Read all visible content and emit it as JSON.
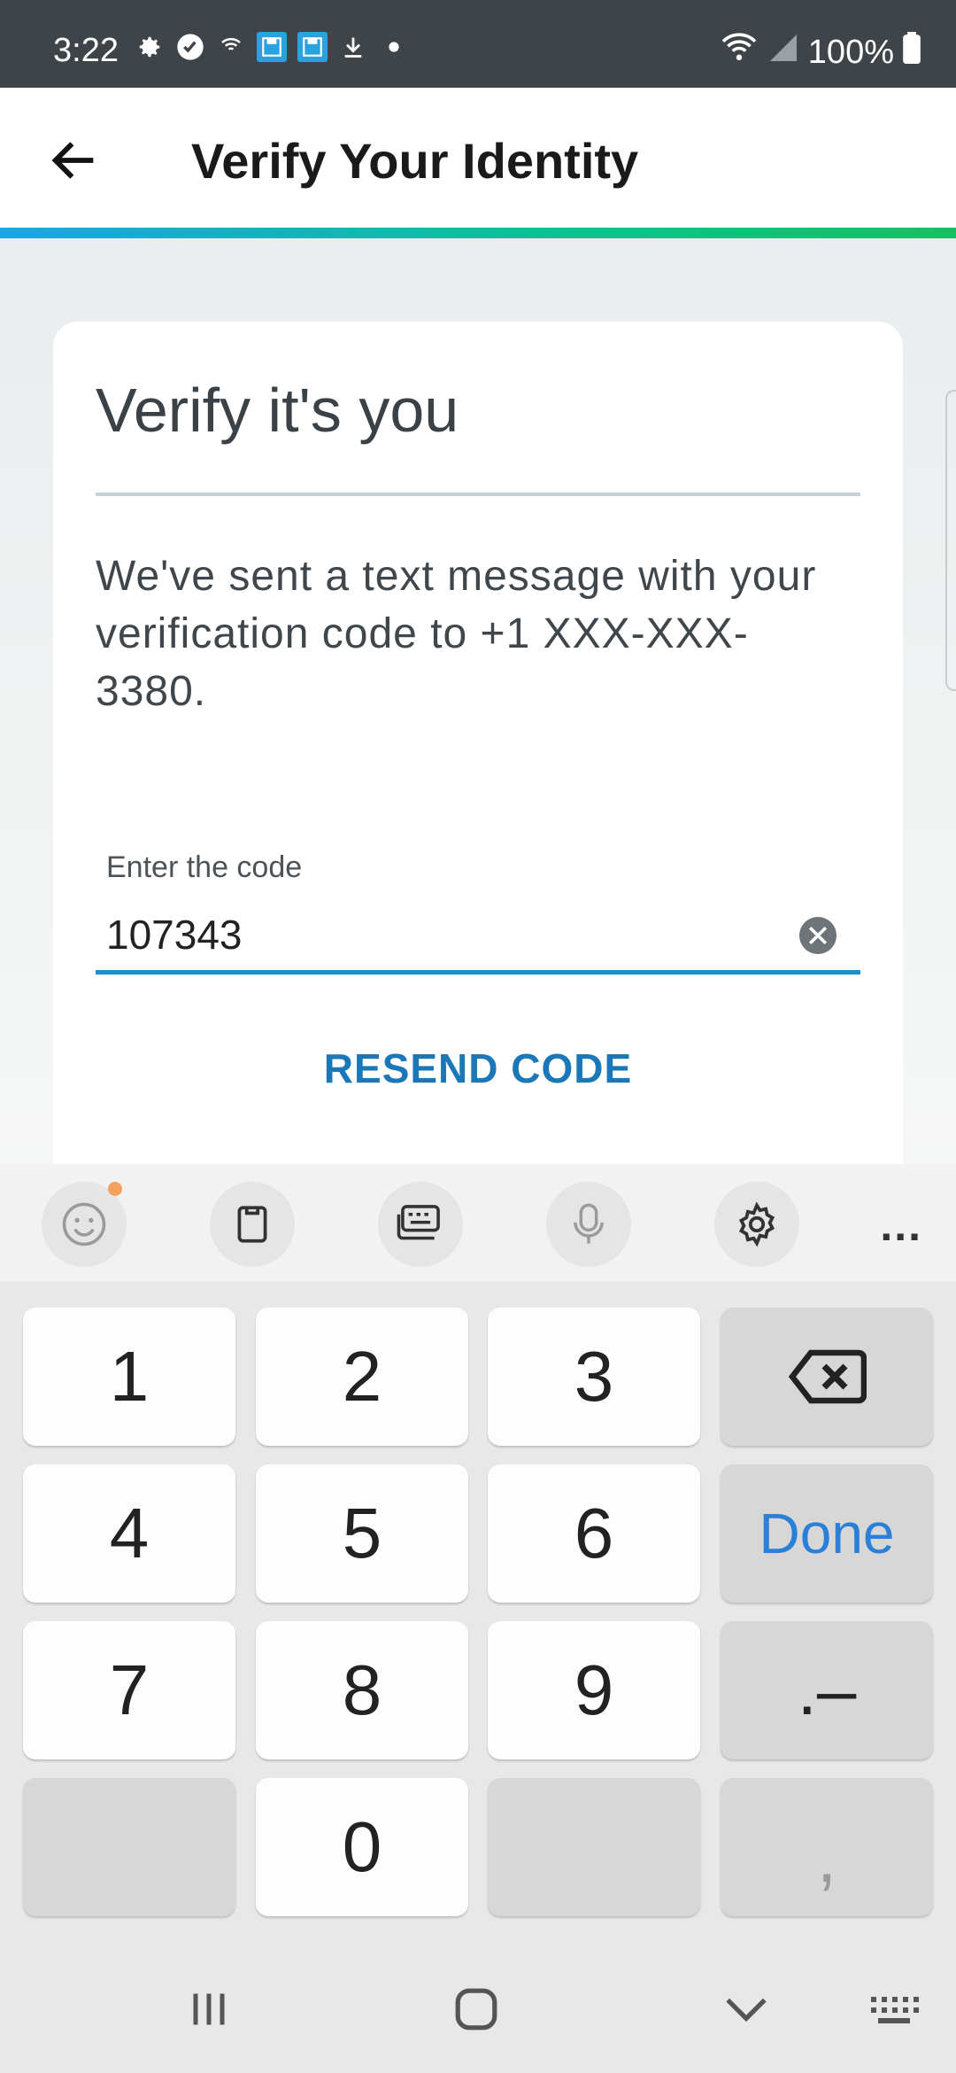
{
  "status_bar": {
    "time": "3:22",
    "battery": "100%",
    "icons": [
      "gear-icon",
      "check-circle-icon",
      "wifi-call-icon",
      "save-icon",
      "save-icon",
      "download-icon",
      "dot-icon"
    ]
  },
  "app_bar": {
    "title": "Verify Your Identity",
    "back_icon": "arrow-left-icon"
  },
  "colors": {
    "accent_blue": "#1d8fd0",
    "gradient_start": "#1aa5e6",
    "gradient_end": "#16c060",
    "resend": "#1a77b8",
    "done": "#2a7fd8"
  },
  "card": {
    "title": "Verify it's you",
    "message": "We've sent a text message with your verification code to +1 XXX-XXX-3380.",
    "code_field": {
      "label": "Enter the code",
      "value": "107343"
    },
    "resend_label": "RESEND CODE"
  },
  "keyboard_toolbar": {
    "items": [
      "emoji-icon",
      "clipboard-icon",
      "keyboard-icon",
      "microphone-icon",
      "settings-icon",
      "more-icon"
    ],
    "more_label": "..."
  },
  "keyboard": {
    "keys": {
      "k1": "1",
      "k2": "2",
      "k3": "3",
      "k4": "4",
      "k5": "5",
      "k6": "6",
      "k7": "7",
      "k8": "8",
      "k9": "9",
      "k0": "0",
      "done": "Done",
      "symbol": ".–",
      "comma": ","
    }
  }
}
